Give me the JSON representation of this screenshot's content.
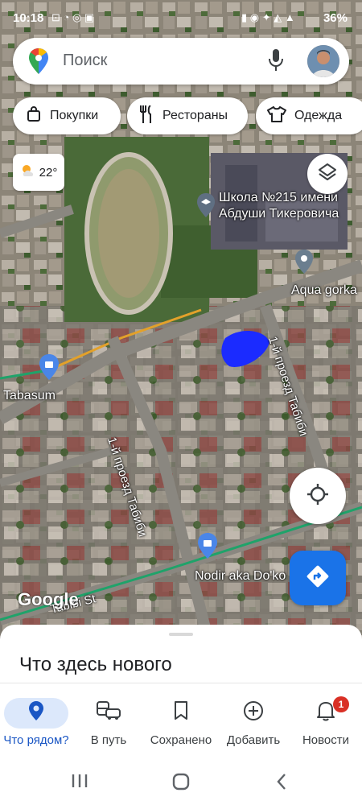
{
  "status_bar": {
    "time": "10:18",
    "battery": "36%"
  },
  "search": {
    "placeholder": "Поиск"
  },
  "chips": [
    {
      "label": "Покупки",
      "icon": "shopping-bag-icon"
    },
    {
      "label": "Рестораны",
      "icon": "restaurant-icon"
    },
    {
      "label": "Одежда",
      "icon": "clothing-icon"
    }
  ],
  "weather": {
    "temp": "22°",
    "icon": "partly-sunny-icon"
  },
  "map_labels": {
    "school": "Школа №215 имени\nАбдуши Тикеровича",
    "aqua": "Aqua gorka",
    "tabasum": "Tabasum",
    "street1": "1-й проезд Табиби",
    "street2": "1-й проезд Табиби",
    "nodir": "Nodir aka Do'ko",
    "tabibi_st": "Tabibi St"
  },
  "google_logo": "Google",
  "sheet": {
    "title": "Что здесь нового"
  },
  "bottom_nav": [
    {
      "label": "Что рядом?",
      "icon": "location-pin-icon",
      "active": true
    },
    {
      "label": "В путь",
      "icon": "commute-icon"
    },
    {
      "label": "Сохранено",
      "icon": "bookmark-icon"
    },
    {
      "label": "Добавить",
      "icon": "add-circle-icon"
    },
    {
      "label": "Новости",
      "icon": "bell-icon",
      "badge": "1"
    }
  ],
  "colors": {
    "accent": "#1a73e8",
    "badge": "#d93025",
    "active_pill": "#dce8fb"
  }
}
